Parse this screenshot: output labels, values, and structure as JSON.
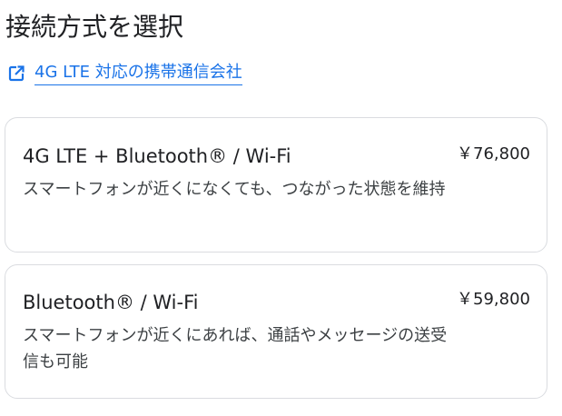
{
  "page": {
    "title": "接続方式を選択"
  },
  "carrier_link": {
    "label": "4G LTE 対応の携帯通信会社",
    "icon": "open-in-new-icon",
    "color": "#1a73e8"
  },
  "options": [
    {
      "name": "4G LTE + Bluetooth® / Wi-Fi",
      "price": "￥76,800",
      "description": "スマートフォンが近くになくても、つながった状態を維持"
    },
    {
      "name": "Bluetooth® / Wi-Fi",
      "price": "￥59,800",
      "description": "スマートフォンが近くにあれば、通話やメッセージの送受信も可能"
    }
  ],
  "colors": {
    "text_primary": "#202124",
    "text_secondary": "#3c4043",
    "card_border": "#dadce0",
    "link": "#1a73e8"
  }
}
